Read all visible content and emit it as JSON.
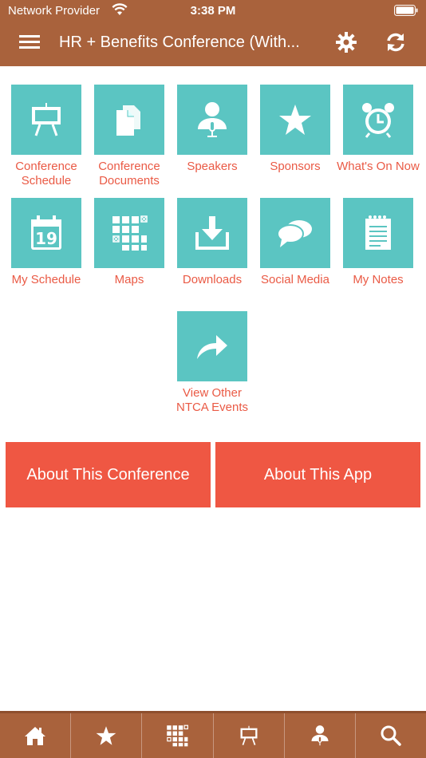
{
  "status": {
    "carrier": "Network Provider",
    "time": "3:38 PM"
  },
  "header": {
    "title": "HR + Benefits Conference (With..."
  },
  "tiles": [
    {
      "label": "Conference Schedule"
    },
    {
      "label": "Conference Documents"
    },
    {
      "label": "Speakers"
    },
    {
      "label": "Sponsors"
    },
    {
      "label": "What's On Now"
    },
    {
      "label": "My Schedule"
    },
    {
      "label": "Maps"
    },
    {
      "label": "Downloads"
    },
    {
      "label": "Social Media"
    },
    {
      "label": "My Notes"
    },
    {
      "label": "View Other NTCA Events"
    }
  ],
  "buttons": {
    "about_conference": "About This Conference",
    "about_app": "About This App"
  },
  "calendar_day": "19",
  "colors": {
    "brand": "#a9623c",
    "tile": "#5bc5c2",
    "label": "#ea5a45",
    "button": "#ef5743"
  }
}
